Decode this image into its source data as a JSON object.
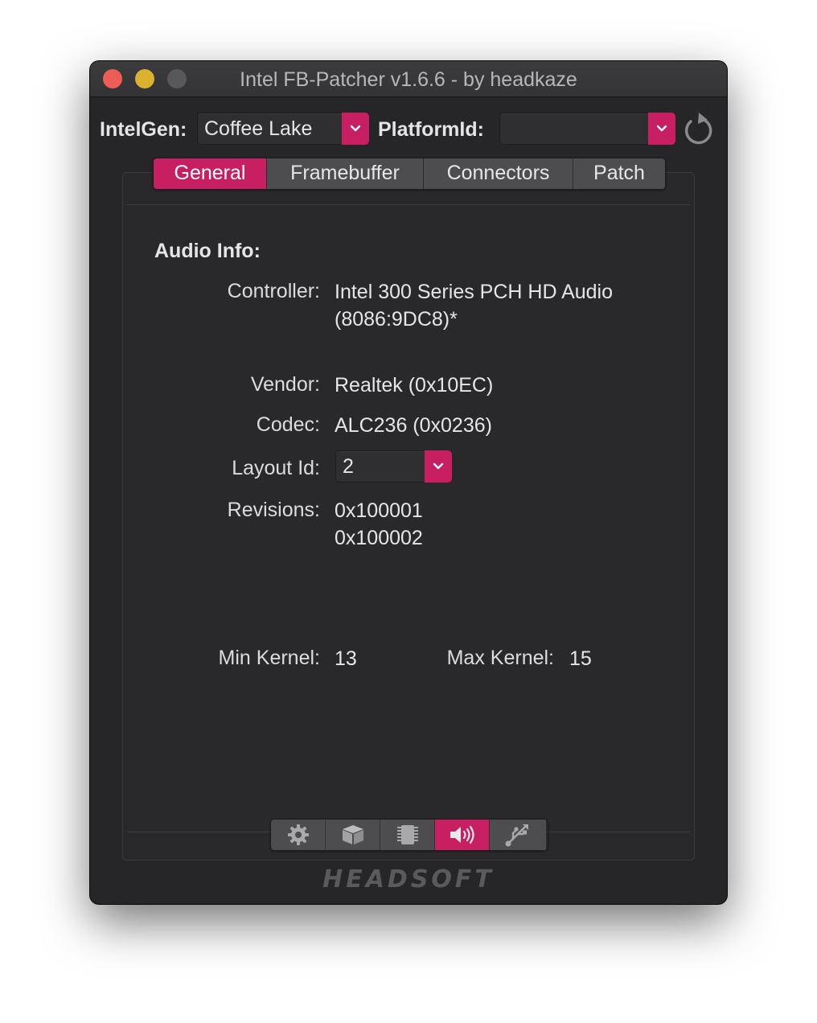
{
  "window": {
    "title": "Intel FB-Patcher v1.6.6 - by headkaze"
  },
  "toolbar": {
    "intelgen_label": "IntelGen:",
    "intelgen_value": "Coffee Lake",
    "platformid_label": "PlatformId:",
    "platformid_value": ""
  },
  "tabs": [
    {
      "label": "General",
      "active": true
    },
    {
      "label": "Framebuffer",
      "active": false
    },
    {
      "label": "Connectors",
      "active": false
    },
    {
      "label": "Patch",
      "active": false
    }
  ],
  "audio": {
    "heading": "Audio Info:",
    "controller_label": "Controller:",
    "controller_line1": "Intel 300 Series PCH HD Audio",
    "controller_line2": "(8086:9DC8)*",
    "vendor_label": "Vendor:",
    "vendor_value": "Realtek (0x10EC)",
    "codec_label": "Codec:",
    "codec_value": "ALC236 (0x0236)",
    "layout_label": "Layout Id:",
    "layout_value": "2",
    "revisions_label": "Revisions:",
    "revisions": [
      "0x100001",
      "0x100002"
    ],
    "min_kernel_label": "Min Kernel:",
    "min_kernel_value": "13",
    "max_kernel_label": "Max Kernel:",
    "max_kernel_value": "15"
  },
  "bottom_buttons": [
    {
      "icon": "gear-icon",
      "active": false
    },
    {
      "icon": "gpu-icon",
      "active": false
    },
    {
      "icon": "chip-icon",
      "active": false
    },
    {
      "icon": "speaker-icon",
      "active": true
    },
    {
      "icon": "usb-icon",
      "active": false
    }
  ],
  "brand": "HEADSOFT",
  "colors": {
    "accent": "#c81f63",
    "window_bg": "#262628",
    "button_bg": "#4d4d50"
  }
}
